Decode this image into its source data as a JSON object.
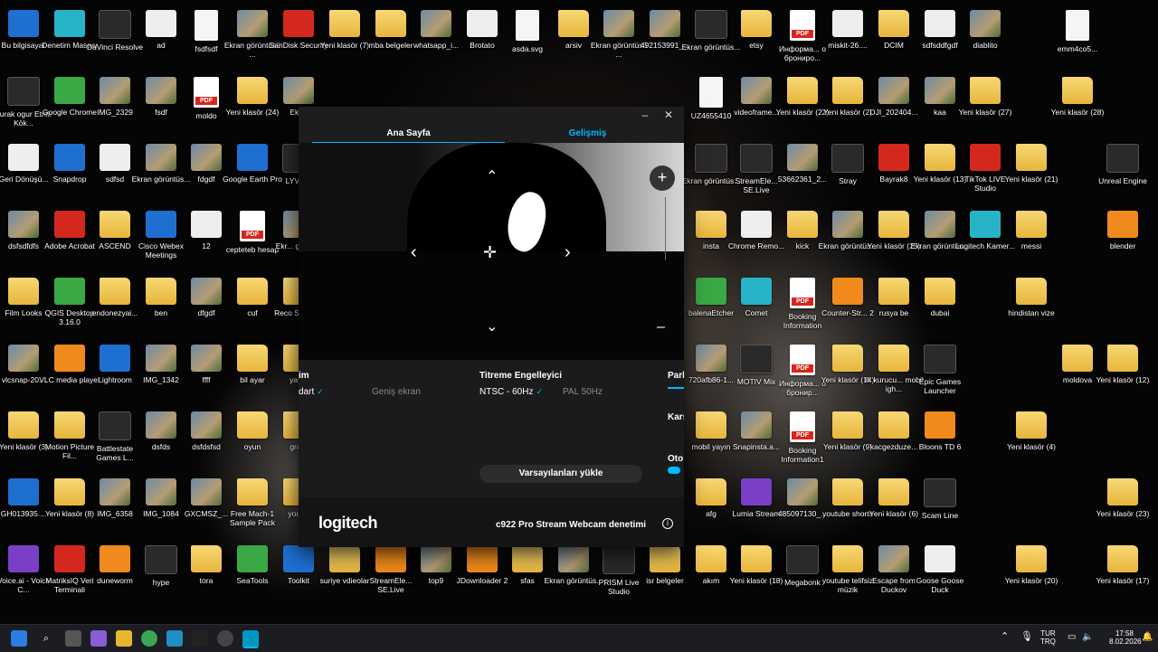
{
  "desktop": {
    "icons": [
      {
        "label": "Bu bilgisayar",
        "type": "blue"
      },
      {
        "label": "Denetim Masası",
        "type": "cyan"
      },
      {
        "label": "DaVinci Resolve",
        "type": "dark"
      },
      {
        "label": "ad",
        "type": "white"
      },
      {
        "label": "fsdfsdf",
        "type": "file"
      },
      {
        "label": "Ekran görüntüsü ...",
        "type": "image"
      },
      {
        "label": "SanDisk Security",
        "type": "red"
      },
      {
        "label": "Yeni klasör (7)",
        "type": "folder"
      },
      {
        "label": "mba belgeler",
        "type": "folder"
      },
      {
        "label": "whatsapp_i...",
        "type": "image"
      },
      {
        "label": "Brotato",
        "type": "white"
      },
      {
        "label": "asda.svg",
        "type": "file"
      },
      {
        "label": "arsiv",
        "type": "folder"
      },
      {
        "label": "Ekran görüntüsü ...",
        "type": "image"
      },
      {
        "label": "492153991_...",
        "type": "image"
      },
      {
        "label": "Ekran görüntüs...",
        "type": "dark"
      },
      {
        "label": "etsy",
        "type": "folder"
      },
      {
        "label": "Информа... о брониро...",
        "type": "pdf"
      },
      {
        "label": "miskit-26....",
        "type": "white"
      },
      {
        "label": "DCIM",
        "type": "folder"
      },
      {
        "label": "sdfsddfgdf",
        "type": "white"
      },
      {
        "label": "diablito",
        "type": "image"
      },
      {
        "label": "emm4co5...",
        "type": "file"
      },
      {
        "label": "burak ogur Etnik Kök...",
        "type": "dark"
      },
      {
        "label": "Google Chrome",
        "type": "green"
      },
      {
        "label": "IMG_2329",
        "type": "image"
      },
      {
        "label": "fsdf",
        "type": "image"
      },
      {
        "label": "moldo",
        "type": "pdf"
      },
      {
        "label": "Yeni klasör (24)",
        "type": "folder"
      },
      {
        "label": "Ekr...",
        "type": "image"
      },
      {
        "label": "UZ4655410",
        "type": "file"
      },
      {
        "label": "videoframe...",
        "type": "image"
      },
      {
        "label": "Yeni klasör (22)",
        "type": "folder"
      },
      {
        "label": "Yeni klasör (2)",
        "type": "folder"
      },
      {
        "label": "DJI_202404...",
        "type": "image"
      },
      {
        "label": "kaa",
        "type": "image"
      },
      {
        "label": "Yeni klasör (27)",
        "type": "folder"
      },
      {
        "label": "Yeni klasör (28)",
        "type": "folder"
      },
      {
        "label": "Geri Dönüşü...",
        "type": "white"
      },
      {
        "label": "Snapdrop",
        "type": "blue"
      },
      {
        "label": "sdfsd",
        "type": "white"
      },
      {
        "label": "Ekran görüntüs...",
        "type": "image"
      },
      {
        "label": "fdgdf",
        "type": "image"
      },
      {
        "label": "Google Earth Pro",
        "type": "blue"
      },
      {
        "label": "LYVC...",
        "type": "dark"
      },
      {
        "label": "Ekran görüntüs...",
        "type": "dark"
      },
      {
        "label": "StreamEle... SE.Live",
        "type": "dark"
      },
      {
        "label": "53662361_2...",
        "type": "image"
      },
      {
        "label": "Stray",
        "type": "dark"
      },
      {
        "label": "Bayrak8",
        "type": "red"
      },
      {
        "label": "Yeni klasör (13)",
        "type": "folder"
      },
      {
        "label": "TikTok LIVE Studio",
        "type": "red"
      },
      {
        "label": "Yeni klasör (21)",
        "type": "folder"
      },
      {
        "label": "Unreal Engine",
        "type": "dark"
      },
      {
        "label": "dsfsdfdfs",
        "type": "image"
      },
      {
        "label": "Adobe Acrobat",
        "type": "red"
      },
      {
        "label": "ASCEND",
        "type": "folder"
      },
      {
        "label": "Cisco Webex Meetings",
        "type": "blue"
      },
      {
        "label": "12",
        "type": "white"
      },
      {
        "label": "cepteteb hesap",
        "type": "pdf"
      },
      {
        "label": "Ekr... görün...",
        "type": "image"
      },
      {
        "label": "insta",
        "type": "folder"
      },
      {
        "label": "Chrome Remo...",
        "type": "white"
      },
      {
        "label": "kick",
        "type": "folder"
      },
      {
        "label": "Ekran görüntüs...",
        "type": "image"
      },
      {
        "label": "Yeni klasör (25)",
        "type": "folder"
      },
      {
        "label": "Ekran görüntüs...",
        "type": "image"
      },
      {
        "label": "Logitech Kamer...",
        "type": "cyan"
      },
      {
        "label": "messi",
        "type": "folder"
      },
      {
        "label": "blender",
        "type": "orange"
      },
      {
        "label": "Film Looks",
        "type": "folder"
      },
      {
        "label": "QGIS Desktop 3.16.0",
        "type": "green"
      },
      {
        "label": "endonezyai...",
        "type": "folder"
      },
      {
        "label": "ben",
        "type": "folder"
      },
      {
        "label": "dfgdf",
        "type": "image"
      },
      {
        "label": "cuf",
        "type": "folder"
      },
      {
        "label": "Reco Sound...",
        "type": "folder"
      },
      {
        "label": "balenaEtcher",
        "type": "green"
      },
      {
        "label": "Comet",
        "type": "cyan"
      },
      {
        "label": "Booking Information",
        "type": "pdf"
      },
      {
        "label": "Counter-Str... 2",
        "type": "orange"
      },
      {
        "label": "rusya be",
        "type": "folder"
      },
      {
        "label": "dubai",
        "type": "folder"
      },
      {
        "label": "hindistan vize",
        "type": "folder"
      },
      {
        "label": "vlcsnap-20...",
        "type": "image"
      },
      {
        "label": "VLC media player",
        "type": "orange"
      },
      {
        "label": "Lightroom",
        "type": "blue"
      },
      {
        "label": "IMG_1342",
        "type": "image"
      },
      {
        "label": "ffff",
        "type": "image"
      },
      {
        "label": "bil ayar",
        "type": "folder"
      },
      {
        "label": "yay...",
        "type": "folder"
      },
      {
        "label": "720afb86-1...",
        "type": "image"
      },
      {
        "label": "MOTIV Mix",
        "type": "dark"
      },
      {
        "label": "Информа... о бронир...",
        "type": "pdf"
      },
      {
        "label": "Yeni klasör (14)",
        "type": "folder"
      },
      {
        "label": "ilk kurucu... mobil igh...",
        "type": "folder"
      },
      {
        "label": "Epic Games Launcher",
        "type": "dark"
      },
      {
        "label": "moldova",
        "type": "folder"
      },
      {
        "label": "Yeni klasör (12)",
        "type": "folder"
      },
      {
        "label": "Yeni klasör (3)",
        "type": "folder"
      },
      {
        "label": "Motion Picture Fil...",
        "type": "folder"
      },
      {
        "label": "Battlestate Games L...",
        "type": "dark"
      },
      {
        "label": "dsfds",
        "type": "image"
      },
      {
        "label": "dsfdsfsd",
        "type": "image"
      },
      {
        "label": "oyun",
        "type": "folder"
      },
      {
        "label": "gra...",
        "type": "folder"
      },
      {
        "label": "mobil yayın",
        "type": "folder"
      },
      {
        "label": "Snapinsta.a...",
        "type": "image"
      },
      {
        "label": "Booking Information1",
        "type": "pdf"
      },
      {
        "label": "Yeni klasör (9)",
        "type": "folder"
      },
      {
        "label": "kacgezduze...",
        "type": "folder"
      },
      {
        "label": "Bloons TD 6",
        "type": "orange"
      },
      {
        "label": "Yeni klasör (4)",
        "type": "folder"
      },
      {
        "label": "GH013935....",
        "type": "blue"
      },
      {
        "label": "Yeni klasör (8)",
        "type": "folder"
      },
      {
        "label": "IMG_6358",
        "type": "image"
      },
      {
        "label": "IMG_1084",
        "type": "image"
      },
      {
        "label": "GXCMSZ_...",
        "type": "image"
      },
      {
        "label": "Free Mach-1 Sample Pack",
        "type": "folder"
      },
      {
        "label": "yout...",
        "type": "folder"
      },
      {
        "label": "afg",
        "type": "folder"
      },
      {
        "label": "Lumia Stream",
        "type": "purple"
      },
      {
        "label": "485097130_...",
        "type": "image"
      },
      {
        "label": "youtube shorts",
        "type": "folder"
      },
      {
        "label": "Yeni klasör (6)",
        "type": "folder"
      },
      {
        "label": "Scam Line",
        "type": "dark"
      },
      {
        "label": "Yeni klasör (23)",
        "type": "folder"
      },
      {
        "label": "Voice.ai - Voice C...",
        "type": "purple"
      },
      {
        "label": "MatriksIQ Veri Terminali",
        "type": "red"
      },
      {
        "label": "duneworm",
        "type": "orange"
      },
      {
        "label": "hype",
        "type": "dark"
      },
      {
        "label": "tora",
        "type": "folder"
      },
      {
        "label": "SeaTools",
        "type": "green"
      },
      {
        "label": "Toolkit",
        "type": "blue"
      },
      {
        "label": "suriye vdieolar",
        "type": "folder"
      },
      {
        "label": "StreamEle... SE.Live",
        "type": "orange"
      },
      {
        "label": "top9",
        "type": "image"
      },
      {
        "label": "JDownloader 2",
        "type": "orange"
      },
      {
        "label": "sfas",
        "type": "folder"
      },
      {
        "label": "Ekran görüntüs...",
        "type": "image"
      },
      {
        "label": "PRISM Live Studio",
        "type": "dark"
      },
      {
        "label": "isr belgeler",
        "type": "folder"
      },
      {
        "label": "akım",
        "type": "folder"
      },
      {
        "label": "Yeni klasör (18)",
        "type": "folder"
      },
      {
        "label": "Megabonk",
        "type": "dark"
      },
      {
        "label": "youtube telifsiz müzik",
        "type": "folder"
      },
      {
        "label": "Escape from Duckov",
        "type": "image"
      },
      {
        "label": "Goose Goose Duck",
        "type": "white"
      },
      {
        "label": "Yeni klasör (20)",
        "type": "folder"
      },
      {
        "label": "Yeni klasör (17)",
        "type": "folder"
      }
    ]
  },
  "window": {
    "tabs": {
      "home": "Ana Sayfa",
      "advanced": "Gelişmiş"
    },
    "controls": {
      "minimize": "–",
      "close": "✕"
    },
    "preview": {
      "up": "⌃",
      "down": "⌄",
      "left": "‹",
      "right": "›",
      "center": "✛",
      "zoom_in": "+",
      "zoom_out": "–"
    },
    "settings": {
      "left_section_title": "im",
      "left_option_selected": "dart",
      "left_option_other": "Geniş ekran",
      "flicker_title": "Titreme Engelleyici",
      "flicker_selected": "NTSC - 60Hz",
      "flicker_other": "PAL 50Hz",
      "right_title_1": "Parl",
      "right_title_2": "Kars",
      "right_title_3": "Oto",
      "reset_label": "Varsayılanları yükle",
      "check": "✓"
    },
    "footer": {
      "logo": "logitech",
      "model": "c922 Pro Stream Webcam denetimi",
      "info": "i"
    }
  },
  "taskbar": {
    "language": "TUR",
    "layout": "TRQ",
    "time": "17:58",
    "date": "8.02.2026"
  },
  "colors": {
    "accent": "#00b8fc"
  }
}
